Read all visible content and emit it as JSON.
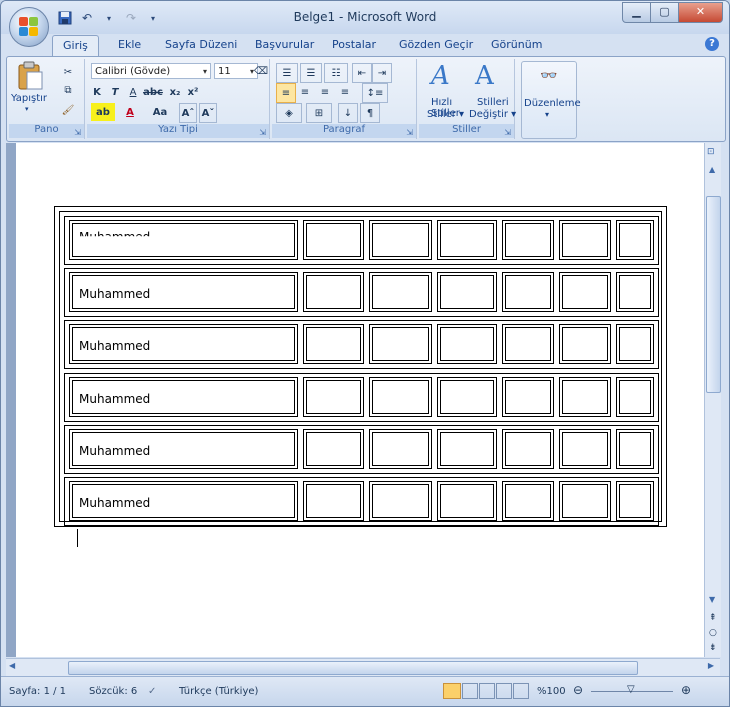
{
  "window": {
    "title": "Belge1 - Microsoft Word",
    "controls": [
      "minimize-icon",
      "maximize-icon",
      "close-icon"
    ]
  },
  "ribbon_tabs": [
    "Giriş",
    "Ekle",
    "Sayfa Düzeni",
    "Başvurular",
    "Postalar",
    "Gözden Geçir",
    "Görünüm"
  ],
  "active_tab": "Giriş",
  "ribbon": {
    "pano": {
      "label": "Pano",
      "paste": "Yapıştır"
    },
    "font": {
      "label": "Yazı Tipi",
      "family": "Calibri (Gövde)",
      "size": "11"
    },
    "paragraph": {
      "label": "Paragraf"
    },
    "styles": {
      "label": "Stiller",
      "quick": "Hızlı Stiller",
      "quick2": "Stiller",
      "change": "Stilleri",
      "change2": "Değiştir"
    },
    "editing": {
      "label": "Düzenleme"
    }
  },
  "document": {
    "rows": [
      {
        "label": "Muhammed"
      },
      {
        "label": "Muhammed"
      },
      {
        "label": "Muhammed"
      },
      {
        "label": "Muhammed"
      },
      {
        "label": "Muhammed"
      },
      {
        "label": "Muhammed"
      }
    ],
    "columns_per_row": 7
  },
  "status": {
    "page": "Sayfa: 1 / 1",
    "words": "Sözcük: 6",
    "language": "Türkçe (Türkiye)",
    "zoom": "%100"
  },
  "colors": {
    "ribbon_text": "#15428b",
    "group_label": "#3e6aaa",
    "status_text": "#1e395b"
  }
}
